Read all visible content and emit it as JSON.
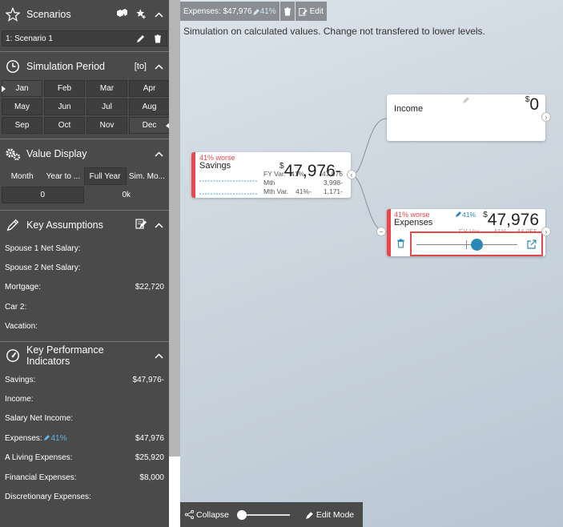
{
  "sidebar": {
    "scenarios": {
      "title": "Scenarios",
      "item": "1: Scenario 1"
    },
    "simulation_period": {
      "title": "Simulation Period",
      "to_label": "[to]",
      "months": [
        "Jan",
        "Feb",
        "Mar",
        "Apr",
        "May",
        "Jun",
        "Jul",
        "Aug",
        "Sep",
        "Oct",
        "Nov",
        "Dec"
      ]
    },
    "value_display": {
      "title": "Value Display",
      "tabs": [
        "Month",
        "Year to ...",
        "Full Year",
        "Sim. Mo..."
      ],
      "selected_tab": "Full Year",
      "values": [
        "0",
        "0k"
      ]
    },
    "key_assumptions": {
      "title": "Key Assumptions",
      "items": [
        {
          "label": "Spouse 1 Net Salary:",
          "value": ""
        },
        {
          "label": "Spouse 2 Net Salary:",
          "value": ""
        },
        {
          "label": "Mortgage:",
          "value": "$22,720"
        },
        {
          "label": "Car 2:",
          "value": ""
        },
        {
          "label": "Vacation:",
          "value": ""
        }
      ]
    },
    "kpi": {
      "title": "Key Performance Indicators",
      "items": [
        {
          "label": "Savings:",
          "value": "$47,976-"
        },
        {
          "label": "Income:",
          "value": ""
        },
        {
          "label": "Salary Net Income:",
          "value": ""
        },
        {
          "label": "Expenses:",
          "pct": "41%",
          "value": "$47,976"
        },
        {
          "label": "A Living Expenses:",
          "value": "$25,920"
        },
        {
          "label": "Financial Expenses:",
          "value": "$8,000"
        },
        {
          "label": "Discretionary Expenses:",
          "value": ""
        }
      ]
    }
  },
  "canvas": {
    "topbar": {
      "label": "Expenses: $47,976",
      "pct": "41%",
      "edit": "Edit"
    },
    "subtitle": "Simulation on calculated values. Change not transfered to lower levels.",
    "income": {
      "name": "Income",
      "currency": "$",
      "value": "0"
    },
    "savings": {
      "worse": "41% worse",
      "name": "Savings",
      "currency": "$",
      "value": "47,976-",
      "fy_var_label": "FY Var.",
      "fy_var_pct": "41%",
      "fy_var_value": "47,976",
      "mth_label": "Mth",
      "mth_value": "3,998-",
      "mth_var_label": "Mth Var.",
      "mth_var_pct": "41%-",
      "mth_var_value": "1,171-"
    },
    "expenses": {
      "worse": "41% worse",
      "name": "Expenses",
      "pct": "41%",
      "currency": "$",
      "value": "47,976",
      "fy_var_label": "FY Var.",
      "fy_var_pct": "41%",
      "fy_var_value": "44,055",
      "slider_value": 0.6
    },
    "bottombar": {
      "collapse": "Collapse",
      "edit_mode": "Edit Mode"
    }
  },
  "colors": {
    "worse": "#e8474e",
    "accent": "#2b87b8",
    "sidebar": "#4a4a4a"
  }
}
